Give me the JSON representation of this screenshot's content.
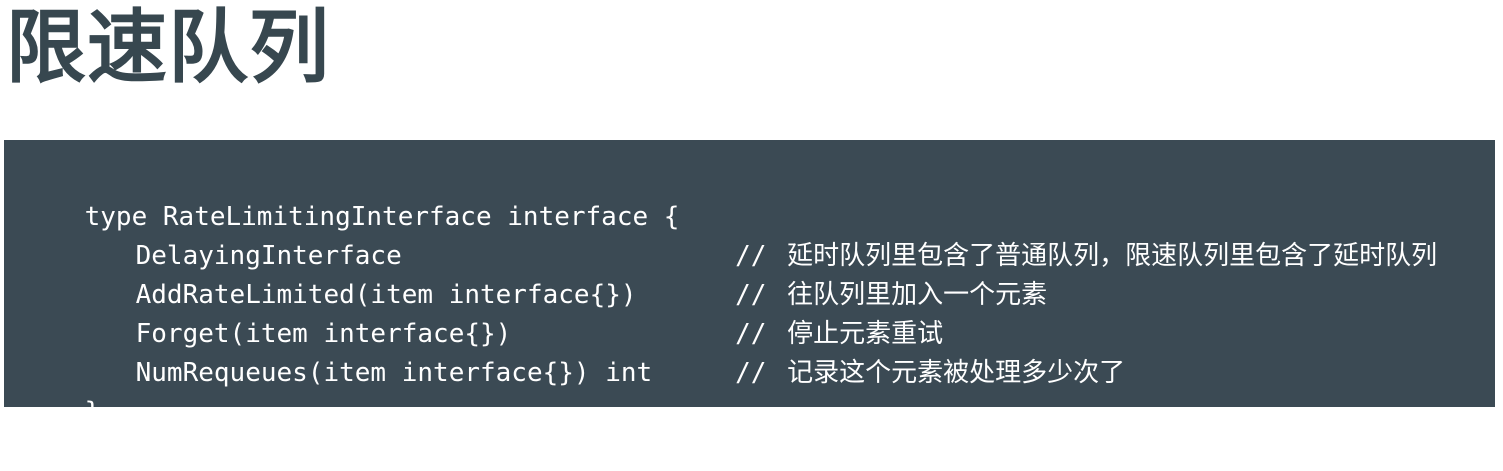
{
  "title": "限速队列",
  "code": {
    "header": "type RateLimitingInterface interface {",
    "members": [
      {
        "signature": "DelayingInterface",
        "comment_prefix": "//",
        "comment": "延时队列里包含了普通队列，限速队列里包含了延时队列"
      },
      {
        "signature": "AddRateLimited(item interface{})",
        "comment_prefix": "//",
        "comment": "往队列里加入一个元素"
      },
      {
        "signature": "Forget(item interface{})",
        "comment_prefix": "//",
        "comment": "停止元素重试"
      },
      {
        "signature": "NumRequeues(item interface{}) int",
        "comment_prefix": "//",
        "comment": "记录这个元素被处理多少次了"
      }
    ],
    "footer": "}"
  },
  "colors": {
    "title": "#37474f",
    "panel_background": "#3b4a54",
    "code_text": "#ffffff"
  }
}
